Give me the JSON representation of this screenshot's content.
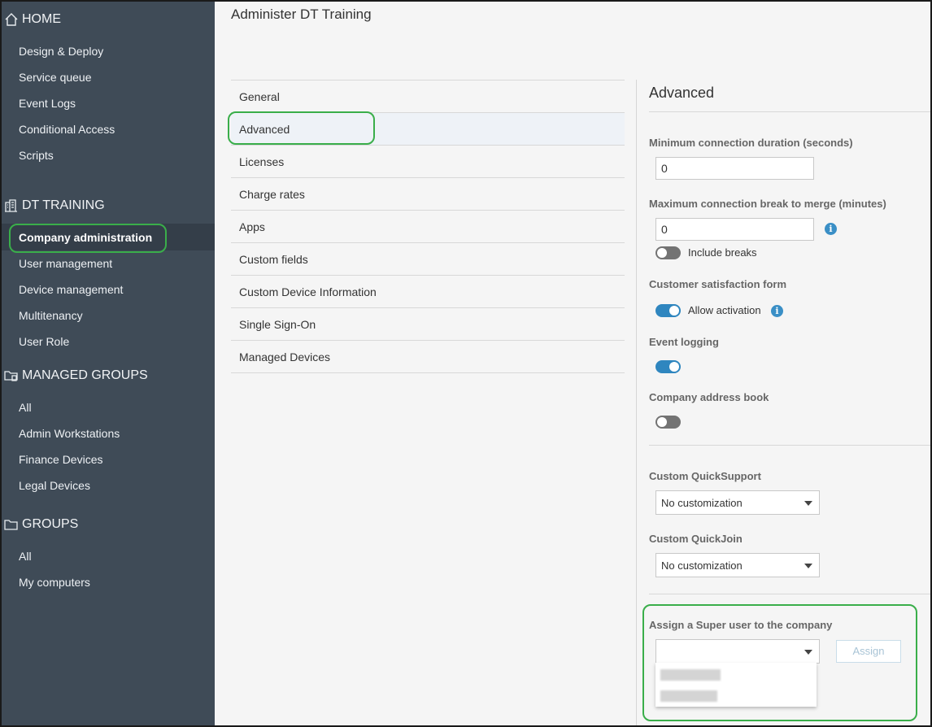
{
  "sidebar": {
    "home": {
      "title": "HOME",
      "items": [
        "Design & Deploy",
        "Service queue",
        "Event Logs",
        "Conditional Access",
        "Scripts"
      ]
    },
    "company": {
      "title": "DT TRAINING",
      "active": "Company administration",
      "items": [
        "User management",
        "Device management",
        "Multitenancy",
        "User Role"
      ]
    },
    "managed_groups": {
      "title": "MANAGED GROUPS",
      "items": [
        "All",
        "Admin Workstations",
        "Finance Devices",
        "Legal Devices"
      ]
    },
    "groups": {
      "title": "GROUPS",
      "items": [
        "All",
        "My computers"
      ]
    }
  },
  "main": {
    "title": "Administer DT Training",
    "tabs": [
      "General",
      "Advanced",
      "Licenses",
      "Charge rates",
      "Apps",
      "Custom fields",
      "Custom Device Information",
      "Single Sign-On",
      "Managed Devices"
    ],
    "active_tab": "Advanced"
  },
  "panel": {
    "title": "Advanced",
    "min_duration": {
      "label": "Minimum connection duration (seconds)",
      "value": "0"
    },
    "max_break": {
      "label": "Maximum connection break to merge (minutes)",
      "value": "0",
      "toggle_label": "Include breaks",
      "toggle_on": false
    },
    "csat": {
      "label": "Customer satisfaction form",
      "toggle_label": "Allow activation",
      "toggle_on": true
    },
    "event_logging": {
      "label": "Event logging",
      "toggle_on": true
    },
    "address_book": {
      "label": "Company address book",
      "toggle_on": false
    },
    "quicksupport": {
      "label": "Custom QuickSupport",
      "value": "No customization"
    },
    "quickjoin": {
      "label": "Custom QuickJoin",
      "value": "No customization"
    },
    "super_user": {
      "label": "Assign a Super user to the company",
      "value": "",
      "button": "Assign"
    }
  },
  "colors": {
    "sidebar_bg": "#3f4b57",
    "accent": "#2f86bf",
    "highlight": "#3aae4a"
  },
  "icons": {
    "home": "home-icon",
    "company": "building-icon",
    "managed_groups": "managed-folder-icon",
    "groups": "folder-icon",
    "info": "info-icon"
  }
}
